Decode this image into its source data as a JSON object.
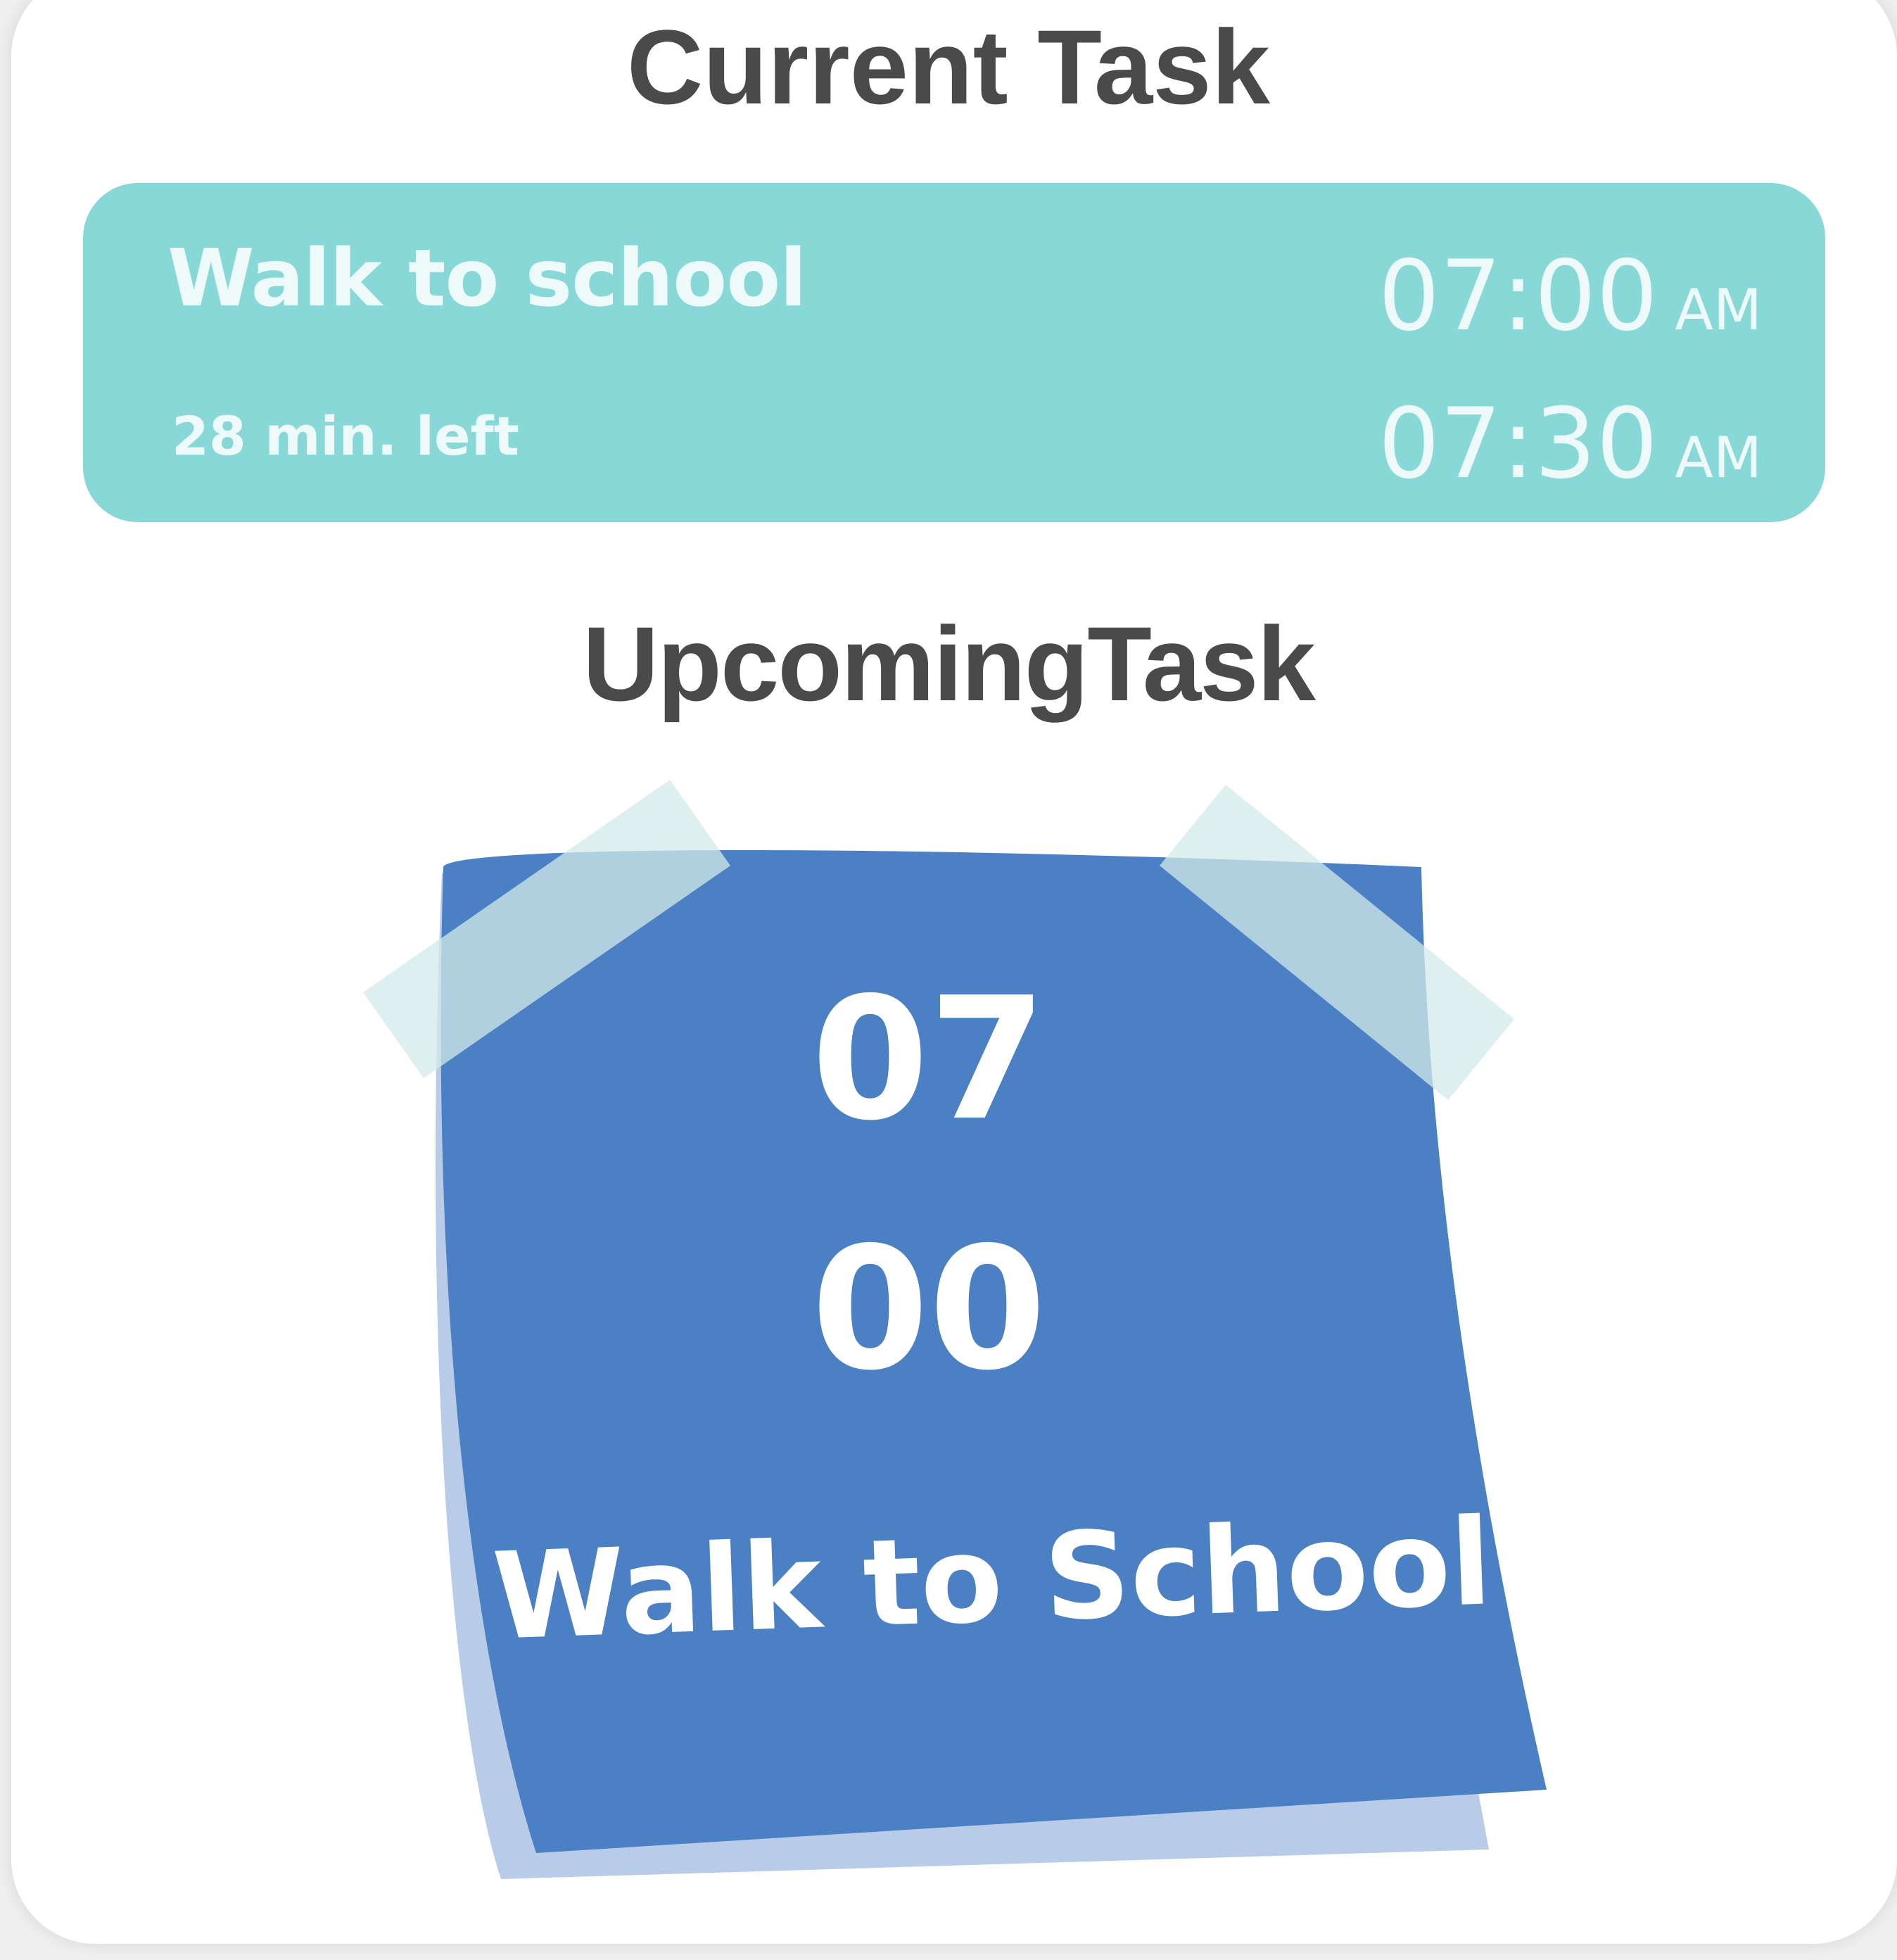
{
  "current": {
    "heading": "Current Task",
    "title": "Walk to school",
    "time_left": "28 min. left",
    "start_time": "07:00",
    "start_period": "AM",
    "end_time": "07:30",
    "end_period": "AM",
    "accent_color": "#88d8d8"
  },
  "upcoming": {
    "heading": "UpcomingTask",
    "hour": "07",
    "minute": "00",
    "title": "Walk to School",
    "note_color": "#4c80c4"
  }
}
